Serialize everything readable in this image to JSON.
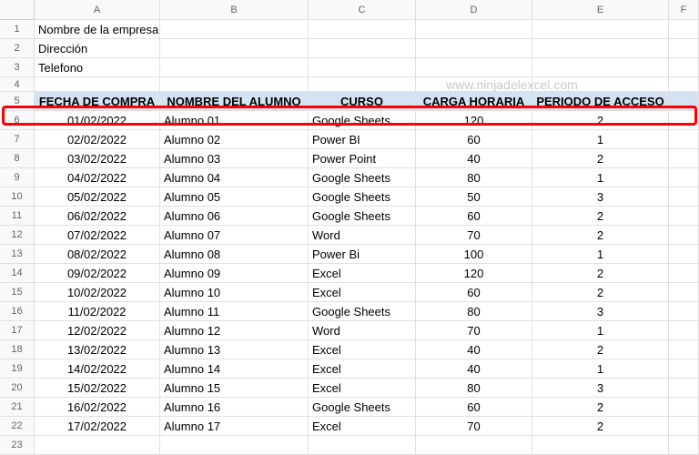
{
  "watermark": "www.ninjadelexcel.com",
  "columns": [
    "A",
    "B",
    "C",
    "D",
    "E",
    "F"
  ],
  "staticRows": {
    "r1": {
      "A": "Nombre de la empresa"
    },
    "r2": {
      "A": "Dirección"
    },
    "r3": {
      "A": "Telefono"
    }
  },
  "headers": {
    "A": "FECHA DE COMPRA",
    "B": "NOMBRE DEL ALUMNO",
    "C": "CURSO",
    "D": "CARGA HORARIA",
    "E": "PERIODO DE ACCESO"
  },
  "rows": [
    {
      "n": 6,
      "A": "01/02/2022",
      "B": "Alumno 01",
      "C": "Google Sheets",
      "D": "120",
      "E": "2"
    },
    {
      "n": 7,
      "A": "02/02/2022",
      "B": "Alumno 02",
      "C": "Power BI",
      "D": "60",
      "E": "1"
    },
    {
      "n": 8,
      "A": "03/02/2022",
      "B": "Alumno 03",
      "C": "Power Point",
      "D": "40",
      "E": "2"
    },
    {
      "n": 9,
      "A": "04/02/2022",
      "B": "Alumno 04",
      "C": "Google Sheets",
      "D": "80",
      "E": "1"
    },
    {
      "n": 10,
      "A": "05/02/2022",
      "B": "Alumno 05",
      "C": "Google Sheets",
      "D": "50",
      "E": "3"
    },
    {
      "n": 11,
      "A": "06/02/2022",
      "B": "Alumno 06",
      "C": "Google Sheets",
      "D": "60",
      "E": "2"
    },
    {
      "n": 12,
      "A": "07/02/2022",
      "B": "Alumno 07",
      "C": "Word",
      "D": "70",
      "E": "2"
    },
    {
      "n": 13,
      "A": "08/02/2022",
      "B": "Alumno 08",
      "C": "Power Bi",
      "D": "100",
      "E": "1"
    },
    {
      "n": 14,
      "A": "09/02/2022",
      "B": "Alumno 09",
      "C": "Excel",
      "D": "120",
      "E": "2"
    },
    {
      "n": 15,
      "A": "10/02/2022",
      "B": "Alumno 10",
      "C": "Excel",
      "D": "60",
      "E": "2"
    },
    {
      "n": 16,
      "A": "11/02/2022",
      "B": "Alumno 11",
      "C": "Google Sheets",
      "D": "80",
      "E": "3"
    },
    {
      "n": 17,
      "A": "12/02/2022",
      "B": "Alumno 12",
      "C": "Word",
      "D": "70",
      "E": "1"
    },
    {
      "n": 18,
      "A": "13/02/2022",
      "B": "Alumno 13",
      "C": "Excel",
      "D": "40",
      "E": "2"
    },
    {
      "n": 19,
      "A": "14/02/2022",
      "B": "Alumno 14",
      "C": "Excel",
      "D": "40",
      "E": "1"
    },
    {
      "n": 20,
      "A": "15/02/2022",
      "B": "Alumno 15",
      "C": "Excel",
      "D": "80",
      "E": "3"
    },
    {
      "n": 21,
      "A": "16/02/2022",
      "B": "Alumno 16",
      "C": "Google Sheets",
      "D": "60",
      "E": "2"
    },
    {
      "n": 22,
      "A": "17/02/2022",
      "B": "Alumno 17",
      "C": "Excel",
      "D": "70",
      "E": "2"
    }
  ]
}
